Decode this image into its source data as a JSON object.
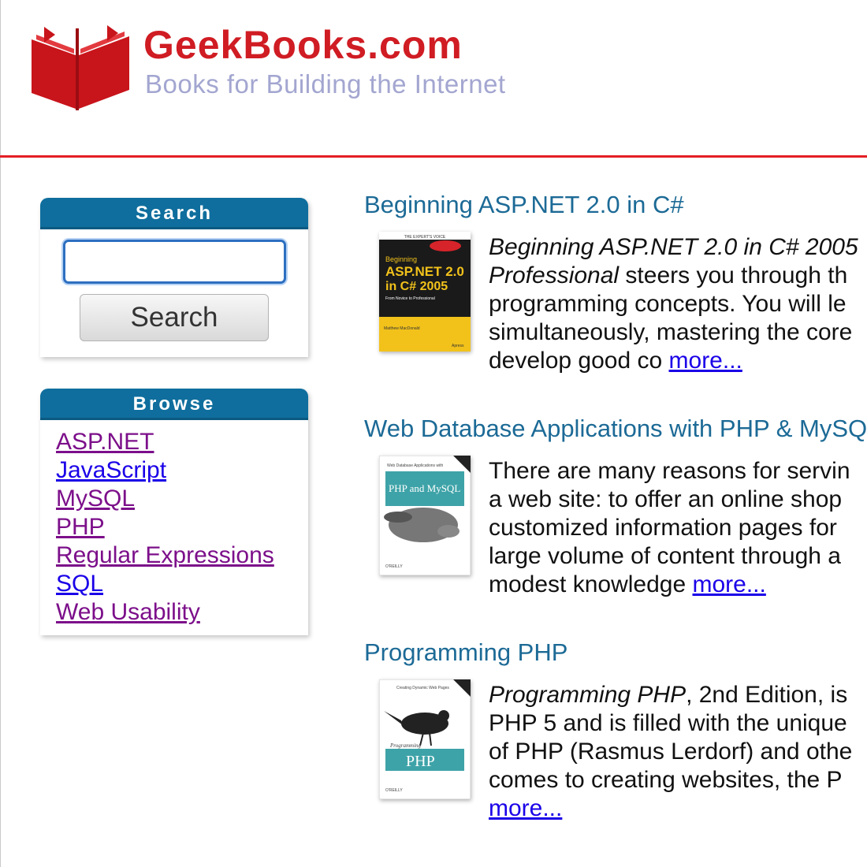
{
  "header": {
    "brand_title": "GeekBooks.com",
    "tagline": "Books for Building the Internet",
    "logo_icon": "open-book-logo",
    "accent_color": "#d01c23",
    "tagline_color": "#a3a6d0",
    "divider_color": "#e31f25"
  },
  "search": {
    "title": "Search",
    "input_value": "",
    "button_label": "Search"
  },
  "browse": {
    "title": "Browse",
    "items": [
      {
        "label": "ASP.NET",
        "visited": true
      },
      {
        "label": "JavaScript",
        "visited": false
      },
      {
        "label": "MySQL",
        "visited": true
      },
      {
        "label": "PHP",
        "visited": true
      },
      {
        "label": "Regular Expressions",
        "visited": true
      },
      {
        "label": "SQL",
        "visited": false
      },
      {
        "label": "Web Usability",
        "visited": true
      }
    ]
  },
  "books": [
    {
      "title": "Beginning ASP.NET 2.0 in C#",
      "cover": {
        "icon": "book-cover-asp-net",
        "badge": "THE EXPERT'S VOICE",
        "line1": "Beginning",
        "line2": "ASP.NET 2.0",
        "line3": "in C# 2005",
        "subtitle": "From Novice to Professional",
        "author": "Matthew MacDonald",
        "publisher": "Apress"
      },
      "blurb_lines": [
        {
          "segments": [
            {
              "text": "Beginning ASP.NET 2.0 in C# 2005",
              "italic": true
            }
          ]
        },
        {
          "segments": [
            {
              "text": "Professional",
              "italic": true
            },
            {
              "text": " steers you through th",
              "italic": false
            }
          ]
        },
        {
          "segments": [
            {
              "text": "programming concepts. You will le",
              "italic": false
            }
          ]
        },
        {
          "segments": [
            {
              "text": "simultaneously, mastering the core",
              "italic": false
            }
          ]
        },
        {
          "segments": [
            {
              "text": "develop good co ",
              "italic": false
            }
          ]
        }
      ],
      "more_label": "more..."
    },
    {
      "title": "Web Database Applications with PHP & MySQL",
      "cover": {
        "icon": "book-cover-php-mysql-platypus",
        "badge": "Web Database Applications with",
        "line1": "PHP and MySQL",
        "publisher": "O'REILLY"
      },
      "blurb_lines": [
        {
          "segments": [
            {
              "text": "There are many reasons for servin",
              "italic": false
            }
          ]
        },
        {
          "segments": [
            {
              "text": "a web site: to offer an online shop",
              "italic": false
            }
          ]
        },
        {
          "segments": [
            {
              "text": "customized information pages for",
              "italic": false
            }
          ]
        },
        {
          "segments": [
            {
              "text": "large volume of content through a",
              "italic": false
            }
          ]
        },
        {
          "segments": [
            {
              "text": "modest knowledge ",
              "italic": false
            }
          ]
        }
      ],
      "more_label": "more..."
    },
    {
      "title": "Programming PHP",
      "cover": {
        "icon": "book-cover-programming-php-bird",
        "badge": "Creating Dynamic Web Pages",
        "line1": "Programming",
        "line2": "PHP",
        "publisher": "O'REILLY"
      },
      "blurb_lines": [
        {
          "segments": [
            {
              "text": "Programming PHP",
              "italic": true
            },
            {
              "text": ", 2nd Edition, is",
              "italic": false
            }
          ]
        },
        {
          "segments": [
            {
              "text": "PHP 5 and is filled with the unique",
              "italic": false
            }
          ]
        },
        {
          "segments": [
            {
              "text": "of PHP (Rasmus Lerdorf) and othe",
              "italic": false
            }
          ]
        },
        {
          "segments": [
            {
              "text": "comes to creating websites, the P",
              "italic": false
            }
          ]
        },
        {
          "segments": []
        }
      ],
      "more_label": "more..."
    }
  ]
}
